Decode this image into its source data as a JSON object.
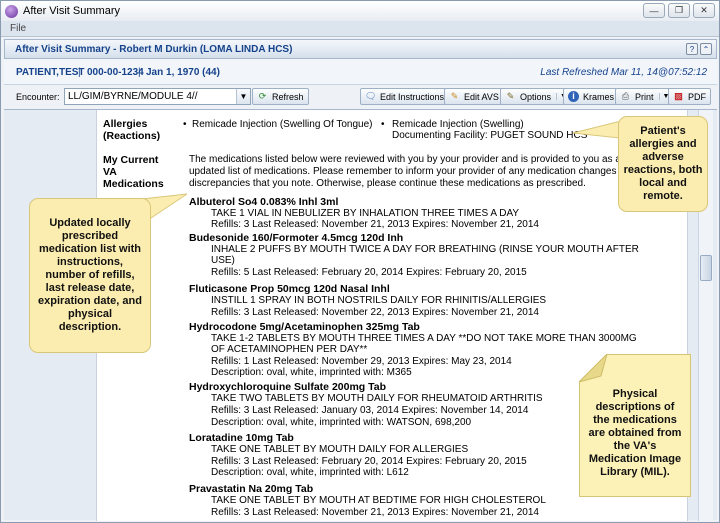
{
  "window": {
    "title": "After Visit Summary",
    "menu_file": "File"
  },
  "header": {
    "title": "After Visit Summary - Robert M Durkin (LOMA LINDA HCS)",
    "help_icon": "?"
  },
  "patient": {
    "name": "PATIENT,TEST",
    "ssn": "000-00-1234",
    "dob": "Jan 1, 1970 (44)",
    "refreshed": "Last Refreshed Mar 11, 14@07:52:12"
  },
  "toolbar": {
    "encounter_label": "Encounter:",
    "encounter_value": "LL/GIM/BYRNE/MODULE 4//",
    "refresh": "Refresh",
    "edit_instructions": "Edit Instructions",
    "edit_avs": "Edit AVS",
    "options": "Options",
    "kramers": "Krames",
    "print": "Print",
    "pdf": "PDF"
  },
  "allergies": {
    "label_1": "Allergies",
    "label_2": "(Reactions)",
    "item_1": "Remicade Injection (Swelling Of Tongue)",
    "item_2": "Remicade Injection (Swelling)",
    "item_2_facility": "Documenting Facility: PUGET SOUND HCS"
  },
  "medications": {
    "label_1": "My Current",
    "label_2": "VA",
    "label_3": "Medications",
    "intro_1": "The medications listed below were reviewed with you by your provider and is provided to you as an",
    "intro_2": "updated list of medications. Please remember to inform your provider of any medication changes or",
    "intro_3": "discrepancies that you note. Otherwise, please continue these medications as prescribed.",
    "items": [
      {
        "name": "Albuterol So4 0.083% Inhl 3ml",
        "instr_1": "TAKE 1 VIAL IN NEBULIZER BY INHALATION THREE TIMES A DAY",
        "instr_2": "",
        "refills": "Refills: 3   Last Released: November 21, 2013   Expires: November 21, 2014",
        "desc": ""
      },
      {
        "name": "Budesonide 160/Formoter 4.5mcg 120d Inh",
        "instr_1": "INHALE 2 PUFFS BY MOUTH TWICE A DAY FOR BREATHING (RINSE YOUR MOUTH AFTER",
        "instr_2": "USE)",
        "refills": "Refills: 5   Last Released: February 20, 2014   Expires: February 20, 2015",
        "desc": ""
      },
      {
        "name": "Fluticasone Prop 50mcg 120d Nasal Inhl",
        "instr_1": "INSTILL 1 SPRAY IN BOTH NOSTRILS DAILY FOR RHINITIS/ALLERGIES",
        "instr_2": "",
        "refills": "Refills: 3   Last Released: November 22, 2013   Expires: November 21, 2014",
        "desc": ""
      },
      {
        "name": "Hydrocodone 5mg/Acetaminophen 325mg Tab",
        "instr_1": "TAKE 1-2 TABLETS BY MOUTH THREE TIMES A DAY **DO NOT TAKE MORE THAN 3000MG",
        "instr_2": "OF ACETAMINOPHEN PER DAY**",
        "refills": "Refills: 1   Last Released: November 29, 2013   Expires: May 23, 2014",
        "desc": "Description: oval, white, imprinted with: M365"
      },
      {
        "name": "Hydroxychloroquine Sulfate 200mg Tab",
        "instr_1": "TAKE TWO TABLETS BY MOUTH DAILY FOR RHEUMATOID ARTHRITIS",
        "instr_2": "",
        "refills": "Refills: 3   Last Released: January 03, 2014   Expires: November 14, 2014",
        "desc": "Description: oval, white, imprinted with: WATSON, 698,200"
      },
      {
        "name": "Loratadine 10mg Tab",
        "instr_1": "TAKE ONE TABLET BY MOUTH DAILY FOR ALLERGIES",
        "instr_2": "",
        "refills": "Refills: 3   Last Released: February 20, 2014   Expires: February 20, 2015",
        "desc": "Description: oval, white, imprinted with: L612"
      },
      {
        "name": "Pravastatin Na 20mg Tab",
        "instr_1": "TAKE ONE TABLET BY MOUTH AT BEDTIME FOR HIGH CHOLESTEROL",
        "instr_2": "",
        "refills": "Refills: 3   Last Released: November 21, 2013   Expires: November 21, 2014",
        "desc": ""
      }
    ]
  },
  "callouts": {
    "allergies": "Patient's allergies and adverse reactions, both local and remote.",
    "medications": "Updated locally prescribed medication list with instructions, number of refills, last release date, expiration date, and physical description.",
    "mil": "Physical descriptions of the medications are obtained from the VA's Medication Image Library (MIL)."
  },
  "colors": {
    "accent": "#15428b",
    "callout_fill": "#fbedb0"
  }
}
